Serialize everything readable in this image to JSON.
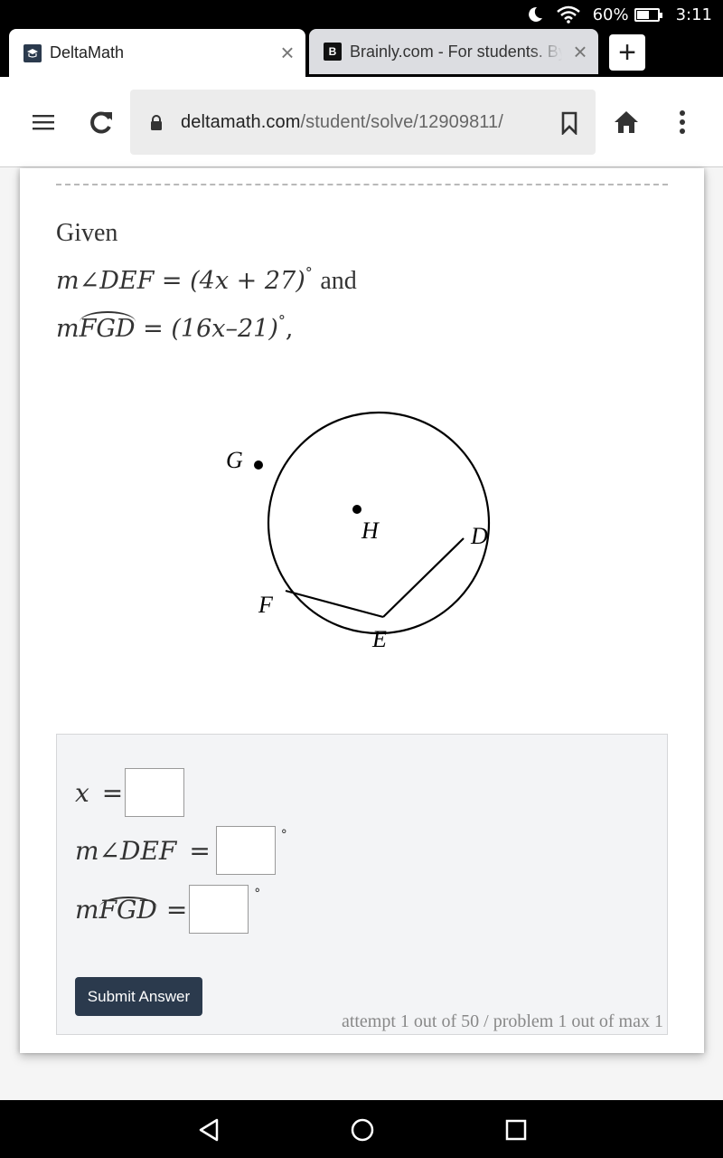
{
  "status_bar": {
    "icons": [
      "moon-icon",
      "wifi-icon",
      "battery-icon"
    ],
    "battery_percent": "60%",
    "battery_level": 0.6,
    "time": "3:11"
  },
  "tabs": [
    {
      "title": "DeltaMath",
      "favicon": "graduation-cap-icon",
      "active": true
    },
    {
      "title": "Brainly.com - For students. By students.",
      "favicon": "brainly-b-icon",
      "active": false
    }
  ],
  "new_tab_label": "+",
  "toolbar": {
    "url_domain": "deltamath.com",
    "url_path": "/student/solve/12909811/"
  },
  "problem": {
    "intro": "Given",
    "line1_lhs": "m∠DEF",
    "line1_eq": "=",
    "line1_rhs": "(4x + 27)",
    "line1_deg": "°",
    "line1_tail": "and",
    "line2_m": "m",
    "line2_arc": "FGD",
    "line2_eq": "=",
    "line2_rhs": "(16x–21)",
    "line2_deg": "°",
    "line2_tail": ","
  },
  "diagram": {
    "points": {
      "G": "G",
      "H": "H",
      "D": "D",
      "F": "F",
      "E": "E"
    }
  },
  "answers": {
    "x_label": "x",
    "eq": "=",
    "angle_label": "m∠DEF",
    "arc_m": "m",
    "arc_label": "FGD",
    "deg": "°",
    "x_value": "",
    "angle_value": "",
    "arc_value": ""
  },
  "submit_label": "Submit Answer",
  "attempt_text": "attempt 1 out of 50 / problem 1 out of max 1"
}
